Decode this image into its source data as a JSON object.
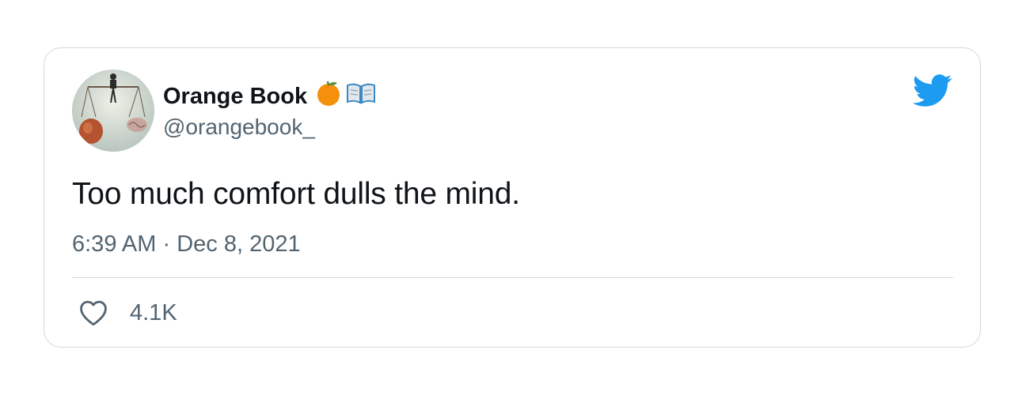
{
  "tweet": {
    "author": {
      "name": "Orange Book",
      "name_emoji": [
        "orange-emoji",
        "open-book-emoji"
      ],
      "handle": "@orangebook_",
      "avatar": "avatar-image"
    },
    "text": "Too much comfort dulls the mind.",
    "time": "6:39 AM",
    "separator": "·",
    "date": "Dec 8, 2021",
    "likes": "4.1K",
    "platform_icon": "twitter-bird-icon"
  },
  "colors": {
    "brand": "#1d9bf0",
    "text_primary": "#0f1419",
    "text_secondary": "#536471",
    "border": "#cfd9de"
  }
}
